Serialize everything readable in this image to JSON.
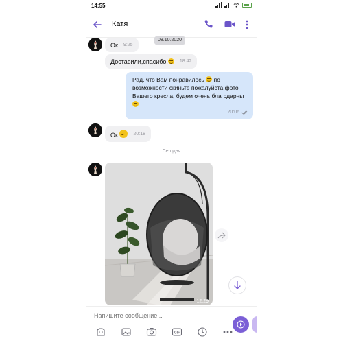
{
  "status_bar": {
    "time": "14:55"
  },
  "header": {
    "contact_name": "Катя"
  },
  "date_chip": "08.10.2020",
  "messages": [
    {
      "text": "Ок",
      "time": "9:25"
    },
    {
      "text": "Доставили,спасибо!",
      "time": "18:42"
    },
    {
      "text": "Рад, что Вам понравилось",
      "text2": "по возможности скиньте пожалуйста фото Вашего кресла, будем очень благодарны",
      "time": "20:06"
    },
    {
      "text": "Ок",
      "time": "20:18"
    }
  ],
  "day_separator": "Сегодня",
  "photo_message": {
    "time": "12:29"
  },
  "composer": {
    "placeholder": "Напишите сообщение..."
  },
  "colors": {
    "accent": "#7b5fd6",
    "outgoing_bubble": "#d6e6fa",
    "incoming_bubble": "#f0f0f2"
  },
  "icons": [
    "back-arrow-icon",
    "phone-icon",
    "video-icon",
    "more-vertical-icon",
    "share-icon",
    "scroll-down-icon",
    "send-icon",
    "sticker-icon",
    "gallery-icon",
    "camera-icon",
    "gif-icon",
    "timer-icon",
    "more-horizontal-icon"
  ]
}
